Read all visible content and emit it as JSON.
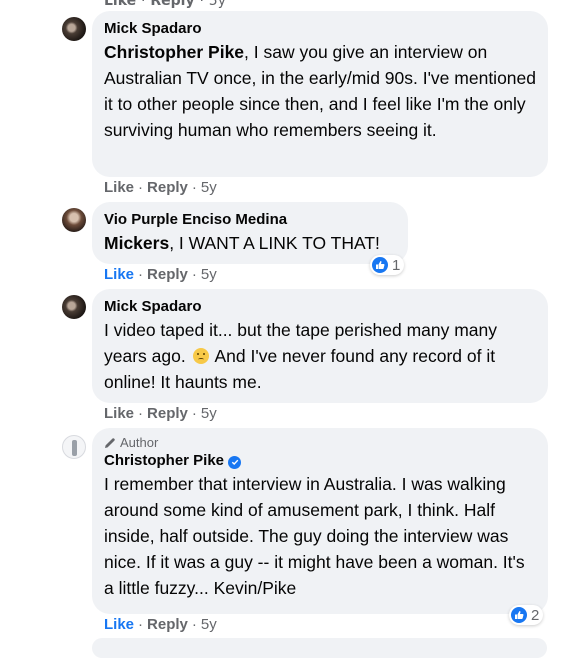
{
  "top_stub": {
    "like": "Like",
    "reply": "Reply",
    "time": "5y"
  },
  "comments": [
    {
      "author": "Mick Spadaro",
      "mention": "Christopher Pike",
      "text": ", I saw you give an interview on Australian TV once, in the early/mid 90s. I've mentioned it to other people since then, and I feel like I'm the only surviving human who remembers seeing it.",
      "like": "Like",
      "reply": "Reply",
      "time": "5y"
    },
    {
      "author": "Vio Purple Enciso Medina",
      "mention": "Mickers",
      "text": ", I WANT A LINK TO THAT!",
      "like": "Like",
      "reply": "Reply",
      "time": "5y",
      "reaction_count": "1"
    },
    {
      "author": "Mick Spadaro",
      "text_before": "I video taped it... but the tape perished many many years ago.",
      "text_after": "And I've never found any record of it online! It haunts me.",
      "like": "Like",
      "reply": "Reply",
      "time": "5y"
    },
    {
      "badge": "Author",
      "author": "Christopher Pike",
      "text": "I remember that interview in Australia. I was walking around some kind of amusement park, I think. Half inside, half outside. The guy doing the interview was nice. If it was a guy -- it might have been a woman. It's a little fuzzy... Kevin/Pike",
      "like": "Like",
      "reply": "Reply",
      "time": "5y",
      "reaction_count": "2"
    }
  ],
  "separator": "·",
  "colors": {
    "accent": "#1877f2",
    "bubble": "#f0f2f5",
    "meta": "#65676b"
  }
}
